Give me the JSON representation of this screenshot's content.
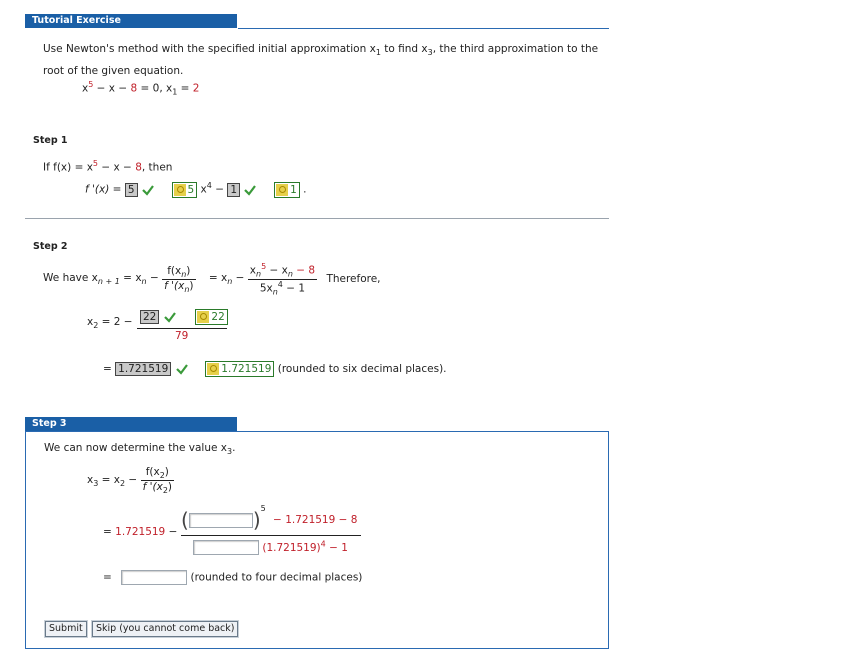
{
  "tutorial": {
    "header": "Tutorial Exercise",
    "intro_line1": "Use Newton's method with the specified initial approximation x",
    "intro_sub1": "1",
    "intro_mid": " to find x",
    "intro_sub3": "3",
    "intro_end": ", the third approximation to the",
    "intro_line2": "root of the given equation.",
    "equation": "x",
    "eq_exp": "5",
    "eq_rest": " − x − ",
    "eq_const": "8",
    "eq_zero": " = 0,   x",
    "x1_sub": "1",
    "x1_eq": " = ",
    "x1_val": "2"
  },
  "step1": {
    "label": "Step 1",
    "if_text": "If  f(x) = x",
    "exp": "5",
    "rest": " − x − ",
    "const": "8",
    "then": ",  then",
    "fprime": "f '(x) = ",
    "ans_a": "5",
    "key_a": "5",
    "x4": " x",
    "x4_exp": "4",
    "minus": " − ",
    "ans_b": "1",
    "key_b": "1",
    "period": "."
  },
  "step2": {
    "label": "Step 2",
    "we_have": "We have  x",
    "sub_n1": "n + 1",
    "eq_xn": " = x",
    "sub_n": "n",
    "minus": " − ",
    "f_num": "f(x",
    "f_den": "f '(x",
    "paren": ")",
    "eq2": " = x",
    "num2": "x",
    "num2_exp": "5",
    "num2_rest": " − x",
    "num2_const": " − 8",
    "den2": "5x",
    "den2_exp": "4",
    "den2_rest": " − 1",
    "therefore": "Therefore,",
    "x2_label": "x",
    "x2_sub": "2",
    "x2_eq": " = 2 − ",
    "ans_22": "22",
    "key_22": "22",
    "den_79": "79",
    "eq_sign": "=",
    "ans_val": "1.721519",
    "key_val": "1.721519",
    "rounding": "(rounded to six decimal places)."
  },
  "step3": {
    "label": "Step 3",
    "intro": "We can now determine the value x",
    "intro_sub": "3",
    "intro_end": ".",
    "x3": "x",
    "x3_sub": "3",
    "x3_eq": " = x",
    "x2_sub": "2",
    "minus": " − ",
    "f_x2": "f(x",
    "fp_x2": "f '(x",
    "close": ")",
    "eq_val": "= ",
    "x2_val": "1.721519",
    "eq_minus": " − ",
    "exp5": "5",
    "num_rest": " − 1.721519 − 8",
    "den_rest": "(1.721519)",
    "den_exp": "4",
    "den_tail": " − 1",
    "final_eq": "=",
    "rounding": "(rounded to four decimal places)"
  },
  "buttons": {
    "submit": "Submit",
    "skip": "Skip (you cannot come back)"
  },
  "colors": {
    "accent": "#1a5fa6",
    "red": "#c0202a",
    "green": "#2a7a2a"
  }
}
